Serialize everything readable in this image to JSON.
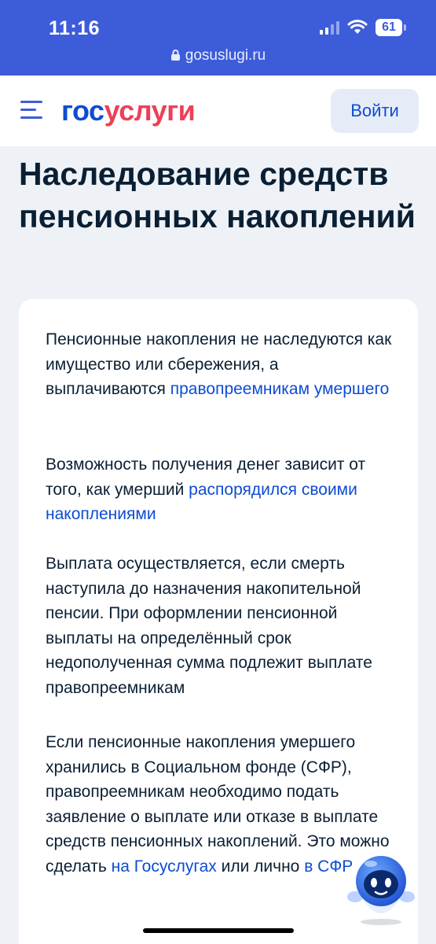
{
  "status_bar": {
    "time": "11:16",
    "battery": "61"
  },
  "browser": {
    "url": "gosuslugi.ru"
  },
  "header": {
    "logo_part1": "гос",
    "logo_part2": "услуги",
    "login_label": "Войти"
  },
  "page": {
    "title": "Наследование средств пенсионных накоплений"
  },
  "paragraphs": [
    {
      "text_before": "Пенсионные накопления не наследуются как имущество или сбережения, а выплачиваются ",
      "link": "правопреемникам умершего"
    },
    {
      "text_before": "Возможность получения денег зависит от того, как умерший ",
      "link": "распорядился своими накоплениями"
    },
    {
      "text": "Выплата осуществляется, если смерть наступила до назначения накопительной пенсии. При оформлении пенсионной выплаты на определённый срок недополученная сумма подлежит выплате правопреемникам"
    },
    {
      "text_before": "Если пенсионные накопления умершего хранились в Социальном фонде (СФР), правопреемникам необходимо подать заявление о выплате или отказе в выплате средств пенсионных накоплений. Это можно сделать ",
      "link1": "на Госуслугах",
      "text_middle": " или лично ",
      "link2": "в СФР"
    }
  ],
  "colors": {
    "brand_blue": "#0d4cd3",
    "brand_red": "#ee3f58",
    "status_bar": "#3d5cda",
    "background": "#eef2f7"
  },
  "icons": [
    "menu-icon",
    "lock-icon",
    "wifi-icon",
    "signal-icon",
    "chatbot-icon"
  ]
}
